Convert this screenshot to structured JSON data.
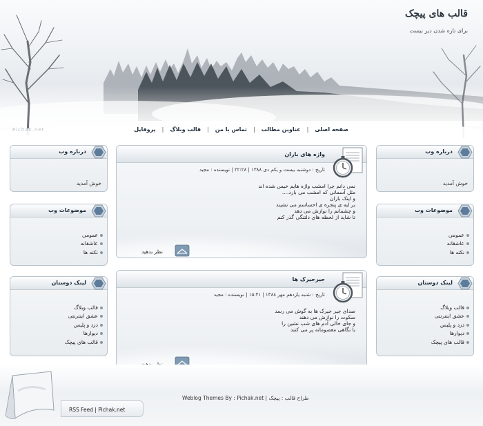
{
  "header": {
    "title": "قالب های پیچک",
    "subtitle": "برای تازه شدن دیر نیست",
    "watermark": "Pichak.net"
  },
  "nav": {
    "items": [
      {
        "label": "صفحه اصلی"
      },
      {
        "label": "عناوین مطالب"
      },
      {
        "label": "تماس با من"
      },
      {
        "label": "قالب وبلاگ"
      },
      {
        "label": "پروفایل"
      }
    ],
    "separator": "|"
  },
  "right_sidebar": {
    "about": {
      "title": "درباره وب",
      "text": "خوش آمدید"
    },
    "topics": {
      "title": "موضوعات وب",
      "items": [
        "عمومی",
        "عاشقانه",
        "نکته ها"
      ]
    },
    "links": {
      "title": "لینک دوستان",
      "items": [
        "قالب وبلاگ",
        "عشق اینترنتی",
        "دزد و پلیس",
        "دیوارها",
        "قالب های پیچک"
      ]
    }
  },
  "left_sidebar": {
    "about": {
      "title": "درباره وب",
      "text": "خوش آمدید"
    },
    "topics": {
      "title": "موضوعات وب",
      "items": [
        "عمومی",
        "عاشقانه",
        "نکته ها"
      ]
    },
    "links": {
      "title": "لینک دوستان",
      "items": [
        "قالب وبلاگ",
        "عشق اینترنتی",
        "دزد و پلیس",
        "دیوارها",
        "قالب های پیچک"
      ]
    }
  },
  "posts": [
    {
      "title": "واژه های باران",
      "meta": "تاریخ : دوشنبه بیست و یکم دی ۱۳۸۸ | ۲۲:۲۸ | نویسنده : مجید",
      "lines": [
        "نمی دانم چرا امشب واژه هایم خیس شده اند",
        "مثل آسمانی که امشب می بارد....",
        "و اینک باران",
        "بر لبه ی پنجره ی احساسم می نشیند",
        "و چشمانم را نوازش می دهد",
        "تا شاید از لحظه های دلتنگی گذر کنم"
      ],
      "comment_label": "نظر بدهید"
    },
    {
      "title": "جیرجیرک ها",
      "meta": "تاریخ : شنبه یازدهم مهر ۱۳۸۸ | ۱۵:۴۱ | نویسنده : مجید",
      "lines": [
        "صدای جیر جیرک ها به گوش می رسد",
        "سکوت را نوازش می دهند",
        "و جای خالی آدم های شب نشین را",
        "با نگاهی معصومانه پر می کنند"
      ],
      "comment_label": "نظر بدهید"
    }
  ],
  "footer": {
    "rss_label": "RSS Feed",
    "separator": "|",
    "site_link": "Pichak.net",
    "credit": "Weblog Themes By : Pichak.net | طراح قالب : پیچک"
  },
  "colors": {
    "accent": "#1d2b3a",
    "hex_badge": "#5d7b9a",
    "box_border": "#b9c3cc"
  },
  "icons": {
    "box_badge": "hexagon-icon",
    "post_badge": "document-stopwatch-icon",
    "comment": "envelope-icon"
  }
}
